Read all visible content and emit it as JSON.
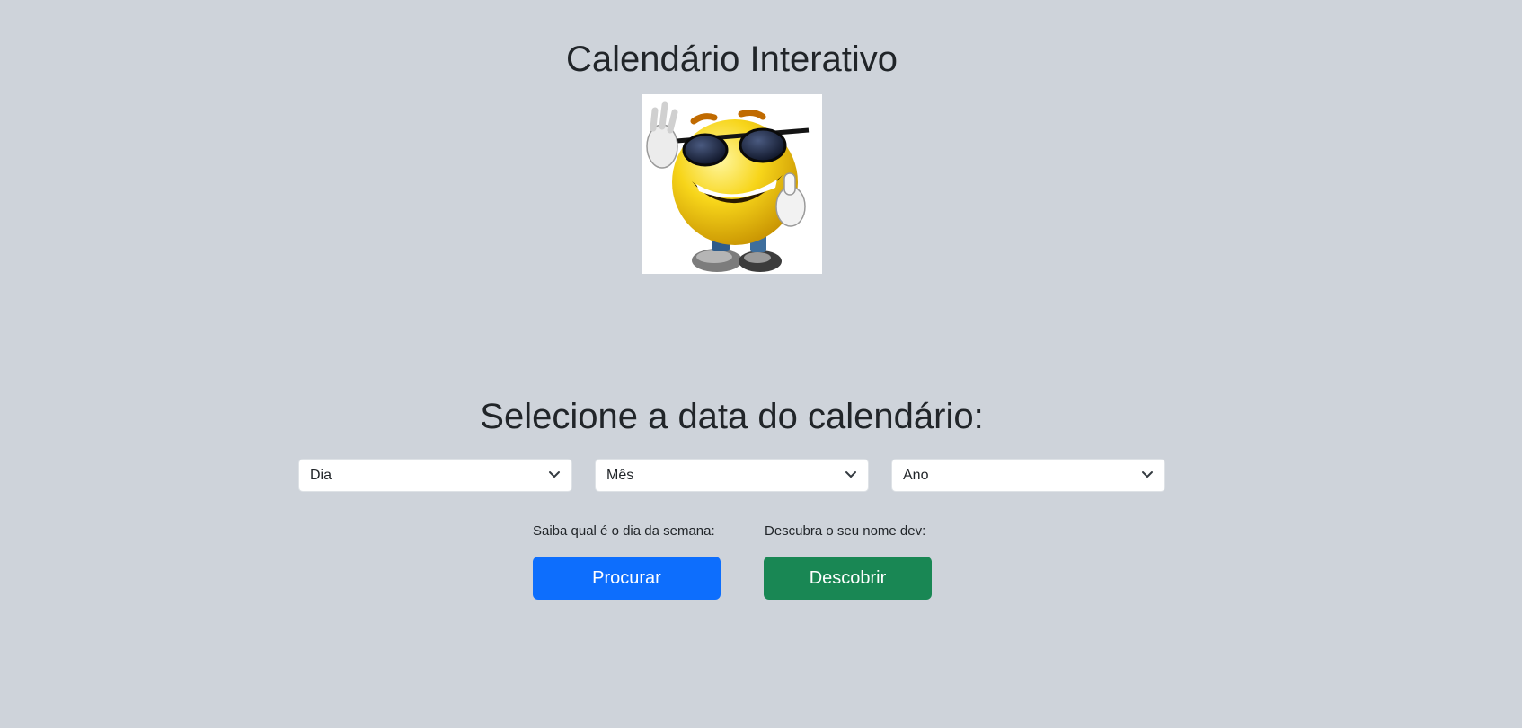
{
  "header": {
    "title": "Calendário Interativo"
  },
  "mascot": {
    "icon": "sunglasses-smiley-icon"
  },
  "form": {
    "title": "Selecione a data do calendário:",
    "day_select": {
      "selected": "Dia"
    },
    "month_select": {
      "selected": "Mês"
    },
    "year_select": {
      "selected": "Ano"
    }
  },
  "actions": {
    "weekday": {
      "label": "Saiba qual é o dia da semana:",
      "button": "Procurar",
      "color": "#0d6efd"
    },
    "devname": {
      "label": "Descubra o seu nome dev:",
      "button": "Descobrir",
      "color": "#198754"
    }
  },
  "colors": {
    "background": "#ced3da",
    "text": "#212529"
  }
}
